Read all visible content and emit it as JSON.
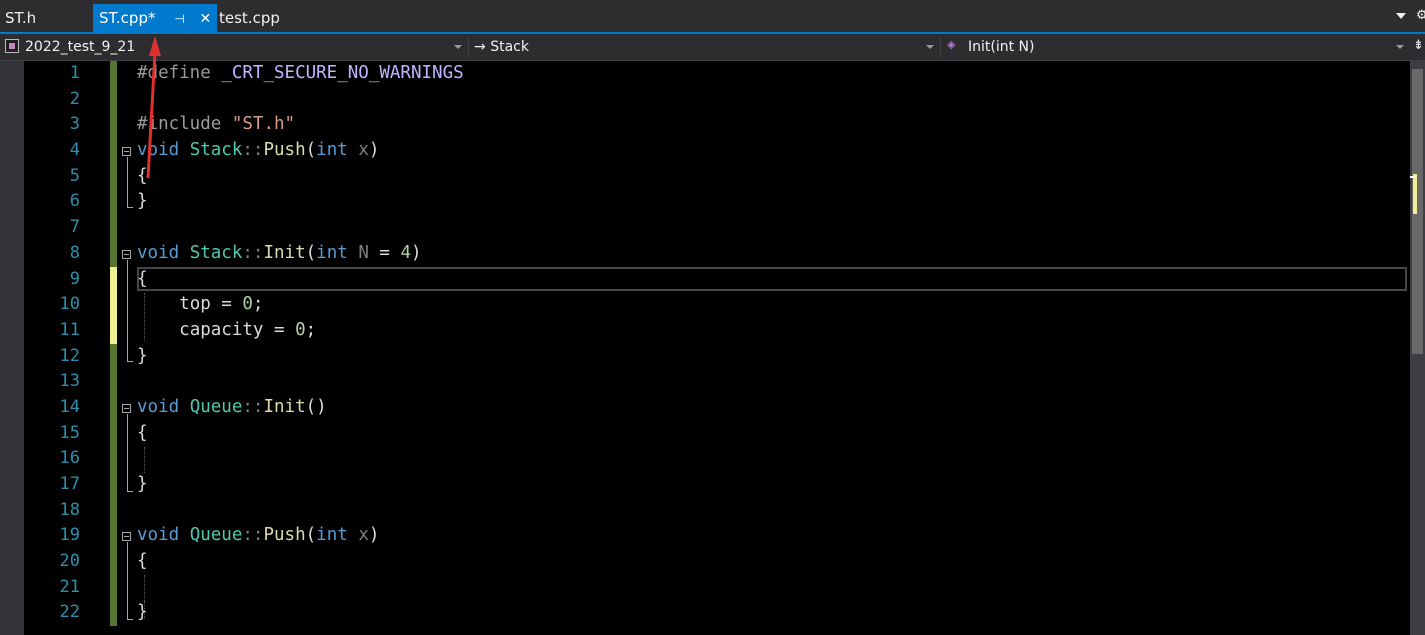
{
  "tabs": [
    {
      "label": "ST.h",
      "active": false
    },
    {
      "label": "ST.cpp*",
      "active": true
    },
    {
      "label": "test.cpp",
      "active": false
    }
  ],
  "tab_icons": {
    "pin": "⊣",
    "close": "✕"
  },
  "navbar": {
    "project": "2022_test_9_21",
    "scope": "Stack",
    "member": "Init(int N)"
  },
  "line_numbers": [
    "1",
    "2",
    "3",
    "4",
    "5",
    "6",
    "7",
    "8",
    "9",
    "10",
    "11",
    "12",
    "13",
    "14",
    "15",
    "16",
    "17",
    "18",
    "19",
    "20",
    "21",
    "22"
  ],
  "colors": {
    "accent": "#007acc",
    "keyword": "#569cd6",
    "type": "#4ec9b0",
    "function": "#dcdcaa",
    "string": "#d69d85",
    "macro": "#beb7ff",
    "number": "#b5cea8",
    "line_number": "#2b91af",
    "saved_change": "#577430",
    "unsaved_change": "#efef91",
    "annotation": "#e03030"
  },
  "code": {
    "l1": {
      "pp": "#define",
      "macro": "_CRT_SECURE_NO_WARNINGS"
    },
    "l3": {
      "pp": "#include",
      "str": "\"ST.h\""
    },
    "l4": {
      "kw": "void",
      "type": "Stack",
      "sep": "::",
      "fn": "Push",
      "open": "(",
      "kw2": "int",
      "param": "x",
      "close": ")"
    },
    "l5": "{",
    "l6": "}",
    "l8": {
      "kw": "void",
      "type": "Stack",
      "sep": "::",
      "fn": "Init",
      "open": "(",
      "kw2": "int",
      "param": "N",
      "eq": " = ",
      "num": "4",
      "close": ")"
    },
    "l9": "{",
    "l10": {
      "var": "top",
      "eq": " = ",
      "num": "0",
      "semi": ";"
    },
    "l11": {
      "var": "capacity",
      "eq": " = ",
      "num": "0",
      "semi": ";"
    },
    "l12": "}",
    "l14": {
      "kw": "void",
      "type": "Queue",
      "sep": "::",
      "fn": "Init",
      "parens": "()"
    },
    "l15": "{",
    "l17": "}",
    "l19": {
      "kw": "void",
      "type": "Queue",
      "sep": "::",
      "fn": "Push",
      "open": "(",
      "kw2": "int",
      "param": "x",
      "close": ")"
    },
    "l20": "{",
    "l22": "}"
  }
}
